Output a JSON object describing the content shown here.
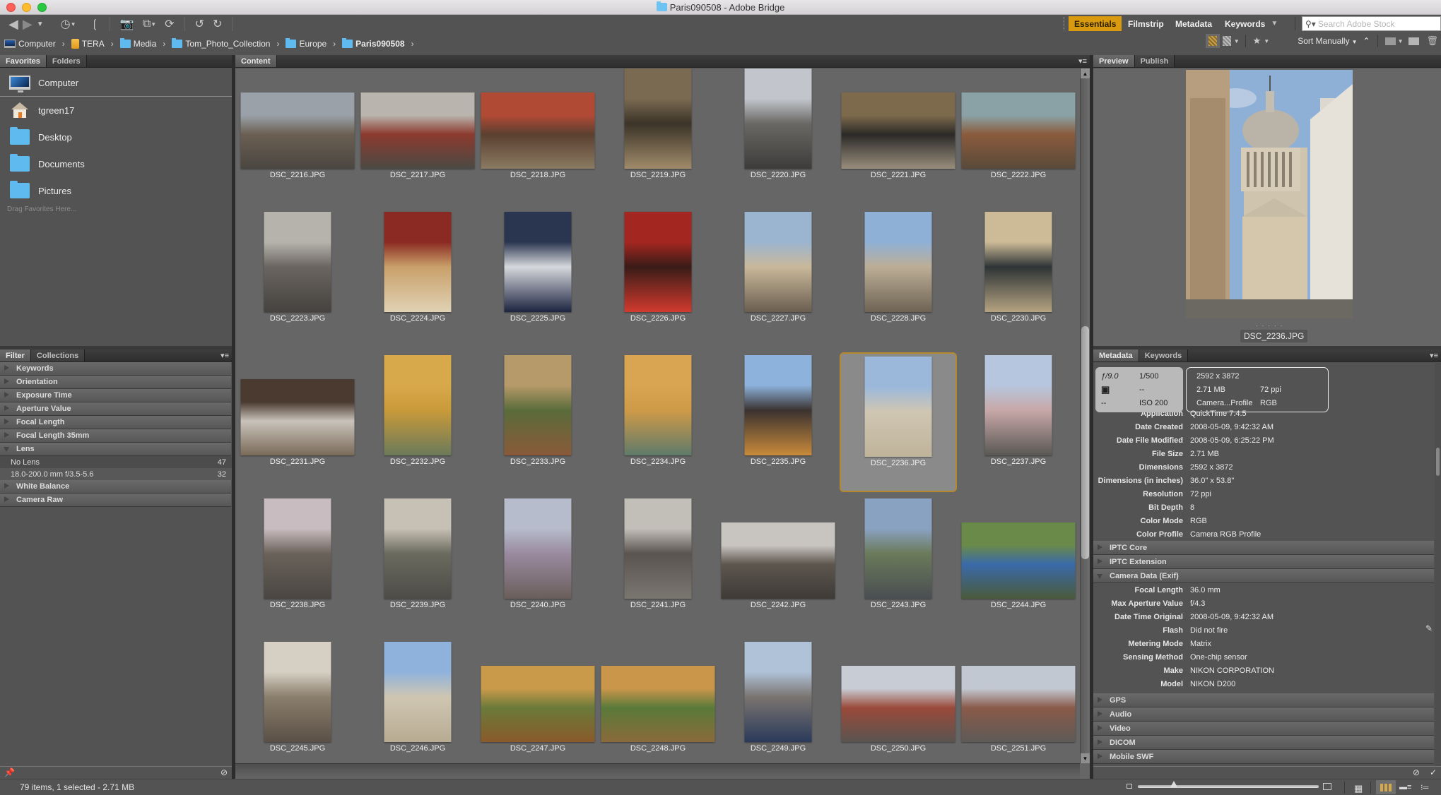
{
  "window": {
    "title": "Paris090508 - Adobe Bridge"
  },
  "toolbar": {
    "workspaces": [
      {
        "label": "Essentials",
        "active": true
      },
      {
        "label": "Filmstrip",
        "active": false
      },
      {
        "label": "Metadata",
        "active": false
      },
      {
        "label": "Keywords",
        "active": false
      }
    ],
    "search_placeholder": "Search Adobe Stock",
    "sort_label": "Sort Manually",
    "accent_color": "#d99a0f"
  },
  "breadcrumb": [
    {
      "label": "Computer",
      "icon": "monitor-icon"
    },
    {
      "label": "TERA",
      "icon": "drive-icon"
    },
    {
      "label": "Media",
      "icon": "folder-icon"
    },
    {
      "label": "Tom_Photo_Collection",
      "icon": "folder-icon"
    },
    {
      "label": "Europe",
      "icon": "folder-icon"
    },
    {
      "label": "Paris090508",
      "icon": "folder-icon"
    }
  ],
  "left_top_panel": {
    "tabs": [
      {
        "label": "Favorites",
        "active": true
      },
      {
        "label": "Folders",
        "active": false
      }
    ],
    "favorites": [
      {
        "label": "Computer",
        "icon": "computer-icon"
      },
      {
        "label": "tgreen17",
        "icon": "home-icon"
      },
      {
        "label": "Desktop",
        "icon": "folder-icon"
      },
      {
        "label": "Documents",
        "icon": "folder-icon"
      },
      {
        "label": "Pictures",
        "icon": "folder-icon"
      }
    ],
    "drag_hint": "Drag Favorites Here..."
  },
  "filter_panel": {
    "tabs": [
      {
        "label": "Filter",
        "active": true
      },
      {
        "label": "Collections",
        "active": false
      }
    ],
    "sections": [
      {
        "label": "Keywords",
        "open": false
      },
      {
        "label": "Orientation",
        "open": false
      },
      {
        "label": "Exposure Time",
        "open": false
      },
      {
        "label": "Aperture Value",
        "open": false
      },
      {
        "label": "Focal Length",
        "open": false
      },
      {
        "label": "Focal Length 35mm",
        "open": false
      },
      {
        "label": "Lens",
        "open": true,
        "items": [
          {
            "label": "No Lens",
            "count": "47"
          },
          {
            "label": "18.0-200.0 mm f/3.5-5.6",
            "count": "32"
          }
        ]
      },
      {
        "label": "White Balance",
        "open": false
      },
      {
        "label": "Camera Raw",
        "open": false
      }
    ]
  },
  "content_panel": {
    "tab": "Content",
    "selected": "DSC_2236.JPG",
    "items": [
      {
        "name": "DSC_2216.JPG",
        "orient": "landscape",
        "colors": [
          "#9aa1a8",
          "#6b5f52",
          "#4a4641"
        ]
      },
      {
        "name": "DSC_2217.JPG",
        "orient": "landscape",
        "colors": [
          "#b9b4ad",
          "#8c3a2e",
          "#4b4a44"
        ]
      },
      {
        "name": "DSC_2218.JPG",
        "orient": "landscape",
        "colors": [
          "#b14a35",
          "#5b4030",
          "#8a7a62"
        ]
      },
      {
        "name": "DSC_2219.JPG",
        "orient": "portrait",
        "colors": [
          "#7a6a52",
          "#3b3428",
          "#a08b6a"
        ]
      },
      {
        "name": "DSC_2220.JPG",
        "orient": "portrait",
        "colors": [
          "#c2c6cc",
          "#6a6865",
          "#3e3c3a"
        ]
      },
      {
        "name": "DSC_2221.JPG",
        "orient": "landscape",
        "colors": [
          "#7d6a4c",
          "#2b2a28",
          "#9a8e7c"
        ]
      },
      {
        "name": "DSC_2222.JPG",
        "orient": "landscape",
        "colors": [
          "#8aa2a6",
          "#8a5b3c",
          "#5a4a3a"
        ]
      },
      {
        "name": "DSC_2223.JPG",
        "orient": "portrait",
        "colors": [
          "#b6b3ad",
          "#6a6560",
          "#45423f"
        ]
      },
      {
        "name": "DSC_2224.JPG",
        "orient": "portrait",
        "colors": [
          "#8a2a22",
          "#c9a06a",
          "#e0d2b4"
        ]
      },
      {
        "name": "DSC_2225.JPG",
        "orient": "portrait",
        "colors": [
          "#2a3550",
          "#d6d8dc",
          "#1c2440"
        ]
      },
      {
        "name": "DSC_2226.JPG",
        "orient": "portrait",
        "colors": [
          "#a42620",
          "#3a1c18",
          "#d23a2e"
        ]
      },
      {
        "name": "DSC_2227.JPG",
        "orient": "portrait",
        "colors": [
          "#9bb4d0",
          "#c9b89a",
          "#6a5e50"
        ]
      },
      {
        "name": "DSC_2228.JPG",
        "orient": "portrait",
        "colors": [
          "#8fb0d6",
          "#bcae96",
          "#6e6354"
        ]
      },
      {
        "name": "DSC_2230.JPG",
        "orient": "portrait",
        "colors": [
          "#cdbb98",
          "#2e3436",
          "#b5a381"
        ]
      },
      {
        "name": "DSC_2231.JPG",
        "orient": "landscape",
        "colors": [
          "#4a3a30",
          "#c9c3bb",
          "#7a6a58"
        ]
      },
      {
        "name": "DSC_2232.JPG",
        "orient": "portrait",
        "colors": [
          "#d8a94a",
          "#c99a3a",
          "#6b7a5a"
        ]
      },
      {
        "name": "DSC_2233.JPG",
        "orient": "portrait",
        "colors": [
          "#b79a6a",
          "#5a6b3a",
          "#8a5a3a"
        ]
      },
      {
        "name": "DSC_2234.JPG",
        "orient": "portrait",
        "colors": [
          "#d9a552",
          "#cf9a48",
          "#5f7a6a"
        ]
      },
      {
        "name": "DSC_2235.JPG",
        "orient": "portrait",
        "colors": [
          "#8db2dc",
          "#3a3230",
          "#c98a3a"
        ]
      },
      {
        "name": "DSC_2236.JPG",
        "orient": "portrait",
        "colors": [
          "#9bb8db",
          "#cfc6b2",
          "#bfb39a"
        ]
      },
      {
        "name": "DSC_2237.JPG",
        "orient": "portrait",
        "colors": [
          "#b6c6de",
          "#c8a8a8",
          "#5a5854"
        ]
      },
      {
        "name": "DSC_2238.JPG",
        "orient": "portrait",
        "colors": [
          "#c9bcc0",
          "#6a625a",
          "#4a4642"
        ]
      },
      {
        "name": "DSC_2239.JPG",
        "orient": "portrait",
        "colors": [
          "#c7c0b4",
          "#6a6a5e",
          "#4e4c48"
        ]
      },
      {
        "name": "DSC_2240.JPG",
        "orient": "portrait",
        "colors": [
          "#b6bccb",
          "#9a8aa0",
          "#6a5e5a"
        ]
      },
      {
        "name": "DSC_2241.JPG",
        "orient": "portrait",
        "colors": [
          "#c2beb8",
          "#5a5450",
          "#7a7670"
        ]
      },
      {
        "name": "DSC_2242.JPG",
        "orient": "landscape",
        "colors": [
          "#c8c4c0",
          "#5c564e",
          "#3e3a36"
        ]
      },
      {
        "name": "DSC_2243.JPG",
        "orient": "portrait",
        "colors": [
          "#8aa2c2",
          "#6a7a5a",
          "#4a4e52"
        ]
      },
      {
        "name": "DSC_2244.JPG",
        "orient": "landscape",
        "colors": [
          "#6a8a4a",
          "#3a6aaa",
          "#4a5a3a"
        ]
      },
      {
        "name": "DSC_2245.JPG",
        "orient": "portrait",
        "colors": [
          "#d6d0c4",
          "#8a7e6c",
          "#5a5046"
        ]
      },
      {
        "name": "DSC_2246.JPG",
        "orient": "portrait",
        "colors": [
          "#8fb2dc",
          "#cfc6b2",
          "#b8ab92"
        ]
      },
      {
        "name": "DSC_2247.JPG",
        "orient": "landscape",
        "colors": [
          "#c99a4a",
          "#6a7a3a",
          "#8a5a2a"
        ]
      },
      {
        "name": "DSC_2248.JPG",
        "orient": "landscape",
        "colors": [
          "#c9964a",
          "#5a7a3a",
          "#8a6a3a"
        ]
      },
      {
        "name": "DSC_2249.JPG",
        "orient": "portrait",
        "colors": [
          "#b0c2d8",
          "#7a7470",
          "#2a3a5a"
        ]
      },
      {
        "name": "DSC_2250.JPG",
        "orient": "landscape",
        "colors": [
          "#c8ccd4",
          "#9a4a3a",
          "#5a5450"
        ]
      },
      {
        "name": "DSC_2251.JPG",
        "orient": "landscape",
        "colors": [
          "#c2c8d2",
          "#8a5a4a",
          "#5e5a56"
        ]
      }
    ]
  },
  "preview_panel": {
    "tabs": [
      {
        "label": "Preview",
        "active": true
      },
      {
        "label": "Publish",
        "active": false
      }
    ],
    "caption": "DSC_2236.JPG"
  },
  "metadata_panel": {
    "tabs": [
      {
        "label": "Metadata",
        "active": true
      },
      {
        "label": "Keywords",
        "active": false
      }
    ],
    "summary": {
      "aperture": "ƒ/9.0",
      "shutter": "1/500",
      "metering": "--",
      "exposure_comp": "--",
      "flash": "--",
      "iso": "ISO 200",
      "dimensions": "2592 x 3872",
      "size": "2.71 MB",
      "resolution": "72 ppi",
      "profile": "Camera...Profile",
      "mode": "RGB"
    },
    "file_properties": [
      {
        "k": "Application",
        "v": "QuickTime 7.4.5"
      },
      {
        "k": "Date Created",
        "v": "2008-05-09, 9:42:32 AM"
      },
      {
        "k": "Date File Modified",
        "v": "2008-05-09, 6:25:22 PM"
      },
      {
        "k": "File Size",
        "v": "2.71 MB"
      },
      {
        "k": "Dimensions",
        "v": "2592 x 3872"
      },
      {
        "k": "Dimensions (in inches)",
        "v": "36.0\" x 53.8\""
      },
      {
        "k": "Resolution",
        "v": "72 ppi"
      },
      {
        "k": "Bit Depth",
        "v": "8"
      },
      {
        "k": "Color Mode",
        "v": "RGB"
      },
      {
        "k": "Color Profile",
        "v": "Camera RGB Profile"
      }
    ],
    "sections_before": [
      {
        "label": "IPTC Core"
      },
      {
        "label": "IPTC Extension"
      }
    ],
    "camera_section": "Camera Data (Exif)",
    "camera_data": [
      {
        "k": "Focal Length",
        "v": "36.0 mm"
      },
      {
        "k": "Max Aperture Value",
        "v": "f/4.3"
      },
      {
        "k": "Date Time Original",
        "v": "2008-05-09, 9:42:32 AM"
      },
      {
        "k": "Flash",
        "v": "Did not fire"
      },
      {
        "k": "Metering Mode",
        "v": "Matrix"
      },
      {
        "k": "Sensing Method",
        "v": "One-chip sensor"
      },
      {
        "k": "Make",
        "v": "NIKON CORPORATION"
      },
      {
        "k": "Model",
        "v": "NIKON D200"
      }
    ],
    "sections_after": [
      {
        "label": "GPS"
      },
      {
        "label": "Audio"
      },
      {
        "label": "Video"
      },
      {
        "label": "DICOM"
      },
      {
        "label": "Mobile SWF"
      }
    ]
  },
  "status": {
    "text": "79 items, 1 selected - 2.71 MB",
    "thumbnail_size_fraction": 0.2
  }
}
